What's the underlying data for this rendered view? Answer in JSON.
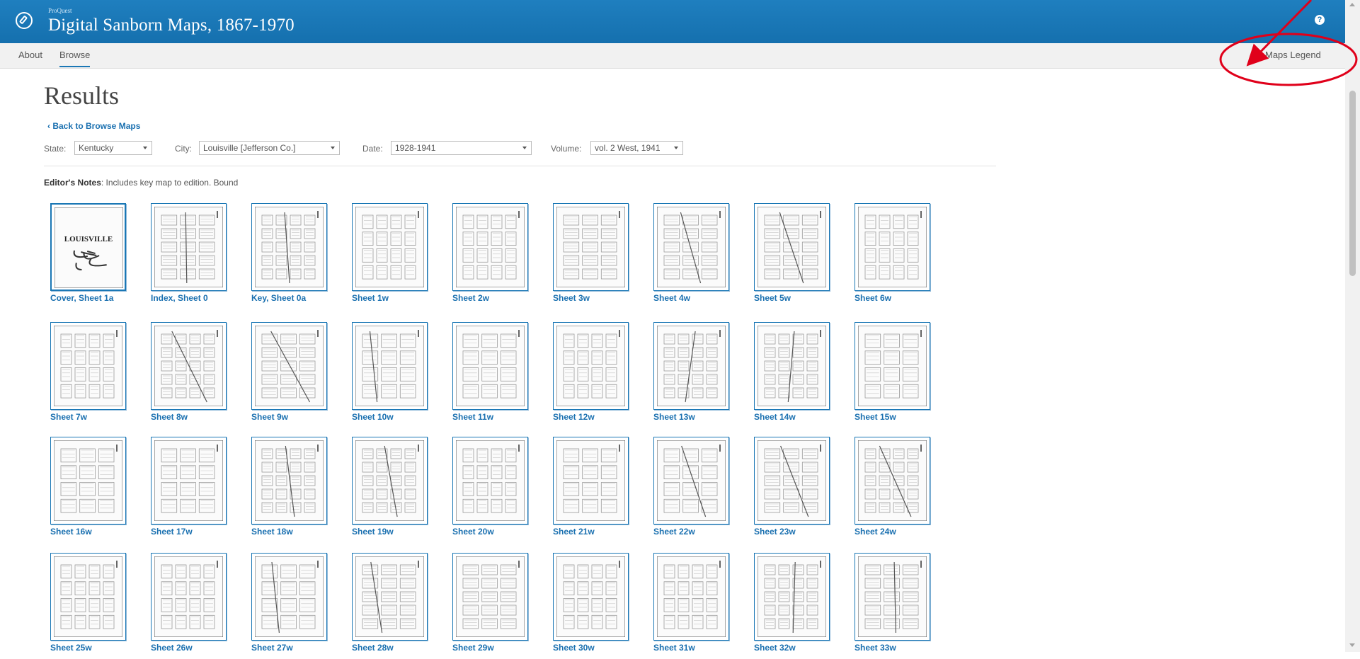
{
  "header": {
    "brand_small": "ProQuest",
    "title": "Digital Sanborn Maps, 1867-1970",
    "logo_icon": "compass-icon",
    "help_icon": "help-icon"
  },
  "nav": {
    "about": "About",
    "browse": "Browse",
    "maps_legend": "Maps Legend"
  },
  "page": {
    "title": "Results",
    "back_link": "‹ Back to Browse Maps",
    "editor_notes_label": "Editor's Notes",
    "editor_notes_text": ": Includes key map to edition. Bound"
  },
  "filters": {
    "state_label": "State:",
    "state_value": "Kentucky",
    "city_label": "City:",
    "city_value": "Louisville [Jefferson Co.]",
    "date_label": "Date:",
    "date_value": "1928-1941",
    "volume_label": "Volume:",
    "volume_value": "vol. 2 West, 1941"
  },
  "sheets": [
    "Cover, Sheet 1a",
    "Index, Sheet 0",
    "Key, Sheet 0a",
    "Sheet 1w",
    "Sheet 2w",
    "Sheet 3w",
    "Sheet 4w",
    "Sheet 5w",
    "Sheet 6w",
    "Sheet 7w",
    "Sheet 8w",
    "Sheet 9w",
    "Sheet 10w",
    "Sheet 11w",
    "Sheet 12w",
    "Sheet 13w",
    "Sheet 14w",
    "Sheet 15w",
    "Sheet 16w",
    "Sheet 17w",
    "Sheet 18w",
    "Sheet 19w",
    "Sheet 20w",
    "Sheet 21w",
    "Sheet 22w",
    "Sheet 23w",
    "Sheet 24w",
    "Sheet 25w",
    "Sheet 26w",
    "Sheet 27w",
    "Sheet 28w",
    "Sheet 29w",
    "Sheet 30w",
    "Sheet 31w",
    "Sheet 32w",
    "Sheet 33w"
  ],
  "cover_text": "LOUISVILLE",
  "colors": {
    "brand_blue": "#1a77b5",
    "link_blue": "#1a70b0",
    "annotation_red": "#e0001a"
  }
}
